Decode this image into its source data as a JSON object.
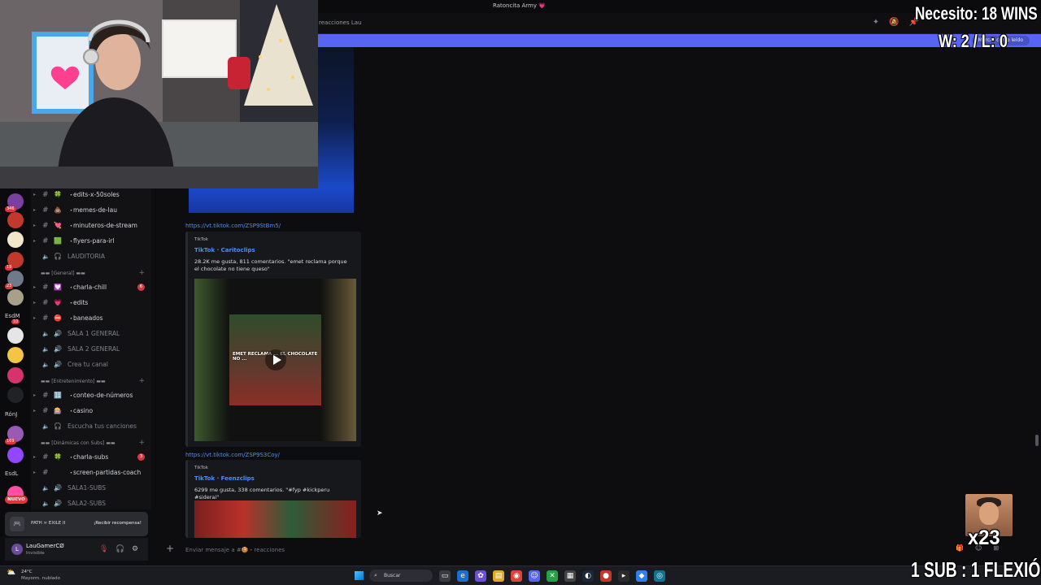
{
  "window": {
    "title": "Ratoncita Army 💗"
  },
  "header": {
    "channel": "reacciones Lau",
    "icons": [
      "thread-icon",
      "mute-bell-icon",
      "pin-icon"
    ]
  },
  "banner": {
    "pill": "Marcar como leído"
  },
  "servers": [
    {
      "label": "",
      "badge": "346",
      "color": "#7b3fa0"
    },
    {
      "label": "",
      "badge": "",
      "color": "#c0392b"
    },
    {
      "label": "",
      "badge": "",
      "color": "#f1e7c9"
    },
    {
      "label": "",
      "badge": "19",
      "color": "#c0392b"
    },
    {
      "label": "",
      "badge": "23",
      "color": "#6e7a8a"
    },
    {
      "label": "",
      "badge": "",
      "color": "#a9a08a"
    },
    {
      "label": "EsdM",
      "badge": "10",
      "color": ""
    },
    {
      "label": "",
      "badge": "",
      "color": "#e5e5e5"
    },
    {
      "label": "",
      "badge": "",
      "color": "#f4c542"
    },
    {
      "label": "",
      "badge": "",
      "color": "#d6336c"
    },
    {
      "label": "tl",
      "badge": "",
      "color": "#202225"
    },
    {
      "label": "RónJ",
      "badge": "",
      "color": ""
    },
    {
      "label": "",
      "badge": "169",
      "color": "#9b59b6"
    },
    {
      "label": "",
      "badge": "",
      "color": "#9146ff"
    },
    {
      "label": "EsdL",
      "badge": "",
      "color": ""
    },
    {
      "label": "",
      "badge": "",
      "color": "#ff4fa3"
    }
  ],
  "rail_new": "NUEVO",
  "channels": [
    {
      "kind": "channel",
      "emoji": "🍀",
      "name": "edits-x-50soles",
      "hash": "#",
      "badge": ""
    },
    {
      "kind": "channel",
      "emoji": "💩",
      "name": "memes-de-lau",
      "hash": "#",
      "badge": ""
    },
    {
      "kind": "channel",
      "emoji": "💘",
      "name": "minuteros-de-stream",
      "hash": "#",
      "badge": ""
    },
    {
      "kind": "channel",
      "emoji": "🟩",
      "name": "flyers-para-irl",
      "hash": "#",
      "badge": ""
    },
    {
      "kind": "voice",
      "emoji": "🎧",
      "name": "LAUDITORIA",
      "hash": "",
      "badge": ""
    },
    {
      "kind": "category",
      "name": "▬▬ [General] ▬▬"
    },
    {
      "kind": "channel",
      "emoji": "💟",
      "name": "charla-chill",
      "hash": "#",
      "badge": "6"
    },
    {
      "kind": "channel",
      "emoji": "💗",
      "name": "edits",
      "hash": "#",
      "badge": ""
    },
    {
      "kind": "channel",
      "emoji": "⛔",
      "name": "baneados",
      "hash": "#",
      "badge": ""
    },
    {
      "kind": "voice",
      "emoji": "🔊",
      "name": "SALA 1 GENERAL",
      "hash": "",
      "badge": ""
    },
    {
      "kind": "voice",
      "emoji": "🔊",
      "name": "SALA 2 GENERAL",
      "hash": "",
      "badge": ""
    },
    {
      "kind": "voice",
      "emoji": "🔊",
      "name": "Crea tu canal",
      "hash": "",
      "badge": ""
    },
    {
      "kind": "category",
      "name": "▬▬ [Entretenimiento] ▬▬"
    },
    {
      "kind": "channel",
      "emoji": "🔢",
      "name": "conteo-de-números",
      "hash": "#",
      "badge": ""
    },
    {
      "kind": "channel",
      "emoji": "🎰",
      "name": "casino",
      "hash": "#",
      "badge": ""
    },
    {
      "kind": "voice",
      "emoji": "🎧",
      "name": "Escucha tus canciones",
      "hash": "",
      "badge": ""
    },
    {
      "kind": "category",
      "name": "▬▬ [Dinámicas con Subs] ▬▬"
    },
    {
      "kind": "channel",
      "emoji": "🍀",
      "name": "charla-subs",
      "hash": "#",
      "badge": "3"
    },
    {
      "kind": "channel",
      "emoji": "",
      "name": "screen-partidas-coach",
      "hash": "#",
      "badge": ""
    },
    {
      "kind": "voice",
      "emoji": "🔊",
      "name": "SALA1-SUBS",
      "hash": "",
      "badge": ""
    },
    {
      "kind": "voice",
      "emoji": "🔊",
      "name": "SALA2-SUBS",
      "hash": "",
      "badge": ""
    }
  ],
  "reward": {
    "left": "PATH ∞ EXILE II",
    "button": "¡Recibir recompensa!"
  },
  "user": {
    "name": "LauGamerCØ",
    "status": "Invisible"
  },
  "messages": [
    {
      "link": "https://vt.tiktok.com/ZSP9StBm5/",
      "provider": "TikTok",
      "title": "TikTok · Caritoclips",
      "desc": "28.2K me gusta, 811 comentarios. \"emet reclama porque el chocolate no tiene queso\"",
      "caption": "EMET RECLAMA ... EL CHOCOLATE NO ..."
    },
    {
      "link": "https://vt.tiktok.com/ZSP9S3Coy/",
      "provider": "TikTok",
      "title": "TikTok · Feenzclips",
      "desc": "6299 me gusta, 338 comentarios. \"#fyp #kickperu #siderai\""
    }
  ],
  "composer": {
    "placeholder": "Enviar mensaje a #🍪・reacciones"
  },
  "overlay": {
    "goal": "Necesito: 18 WINS",
    "record": "W: 2 / L: 0",
    "multiplier": "x23",
    "rule": "1 SUB : 1 FLEXIÓN"
  },
  "taskbar": {
    "temp": "24°C",
    "weather": "Mayorm. nublado",
    "search": "Buscar"
  },
  "colors": {
    "accent": "#5865f2",
    "link": "#4d8df5",
    "danger": "#da373c"
  }
}
